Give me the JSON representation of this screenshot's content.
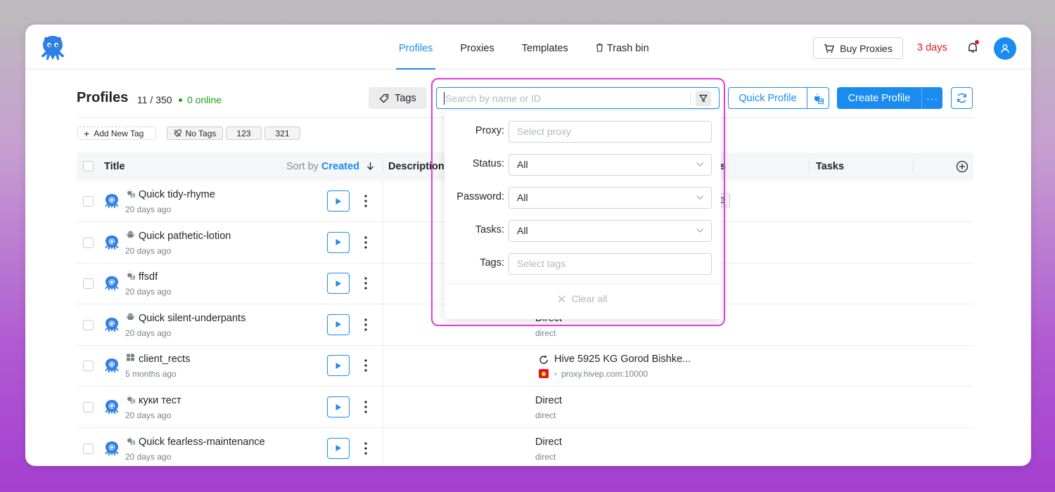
{
  "nav": {
    "items": [
      {
        "label": "Profiles",
        "active": true
      },
      {
        "label": "Proxies",
        "active": false
      },
      {
        "label": "Templates",
        "active": false
      },
      {
        "label": "Trash bin",
        "active": false
      }
    ],
    "buy_label": "Buy Proxies",
    "days_left": "3 days"
  },
  "header": {
    "title": "Profiles",
    "count": "11 / 350",
    "online": "0 online",
    "tags_label": "Tags",
    "search_placeholder": "Search by name or ID",
    "quick_profile_label": "Quick Profile",
    "create_profile_label": "Create Profile",
    "more_label": "···"
  },
  "tag_chips": {
    "add": "Add New Tag",
    "no_tags": "No Tags",
    "t1": "123",
    "t2": "321"
  },
  "table": {
    "col_title": "Title",
    "sort_by": "Sort by",
    "sort_value": "Created",
    "col_description": "Description",
    "col_tasks": "Tasks",
    "rows": [
      {
        "name": "Quick tidy-rhyme",
        "ago": "20 days ago",
        "os": "macos-icon",
        "proxy": "",
        "proxy_sub": ""
      },
      {
        "name": "Quick pathetic-lotion",
        "ago": "20 days ago",
        "os": "android-icon",
        "proxy": "",
        "proxy_sub": ""
      },
      {
        "name": "ffsdf",
        "ago": "20 days ago",
        "os": "macos-icon",
        "proxy": "",
        "proxy_sub": ""
      },
      {
        "name": "Quick silent-underpants",
        "ago": "20 days ago",
        "os": "android-icon",
        "proxy": "Direct",
        "proxy_sub": "direct"
      },
      {
        "name": "client_rects",
        "ago": "5 months ago",
        "os": "windows-icon",
        "proxy": "Hive 5925 KG Gorod Bishke...",
        "proxy_sub": "proxy.hivep.com:10000"
      },
      {
        "name": "куки тест",
        "ago": "20 days ago",
        "os": "macos-icon",
        "proxy": "Direct",
        "proxy_sub": "direct"
      },
      {
        "name": "Quick fearless-maintenance",
        "ago": "20 days ago",
        "os": "macos-icon",
        "proxy": "Direct",
        "proxy_sub": "direct"
      }
    ]
  },
  "filter": {
    "proxy_label": "Proxy:",
    "proxy_placeholder": "Select proxy",
    "status_label": "Status:",
    "status_value": "All",
    "password_label": "Password:",
    "password_value": "All",
    "tasks_label": "Tasks:",
    "tasks_value": "All",
    "tags_label": "Tags:",
    "tags_placeholder": "Select tags",
    "clear_label": "Clear all"
  },
  "colors": {
    "accent": "#1a8cf0",
    "danger": "#e0191f",
    "online": "#17a317",
    "highlight": "#e838d8"
  }
}
